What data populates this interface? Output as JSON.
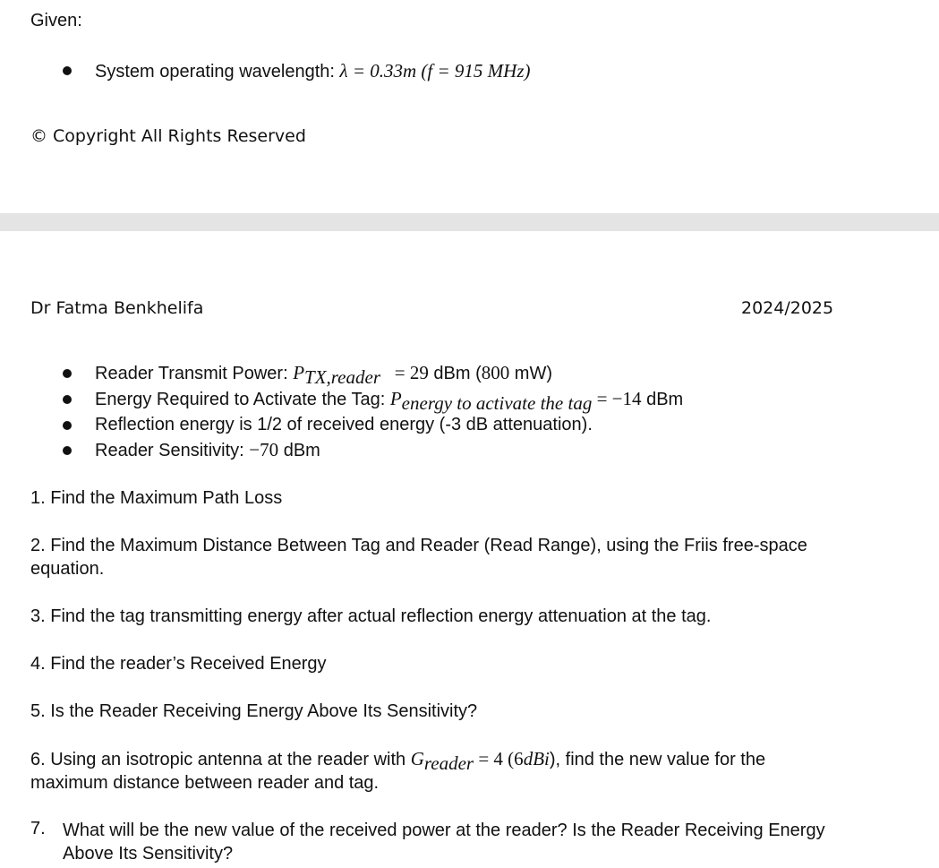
{
  "top": {
    "heading": "Given:",
    "wavelength_label": "System operating wavelength: ",
    "wavelength_math": "λ = 0.33m (f  =  915 MHz)",
    "copyright": "© Copyright All Rights Reserved"
  },
  "header": {
    "author": "Dr Fatma Benkhelifa",
    "year": "2024/2025"
  },
  "given": {
    "tx_label": "Reader Transmit Power: ",
    "tx_sym": "P",
    "tx_sub": "TX,reader",
    "tx_eq": "   = 29",
    "tx_unit": " dBm (",
    "tx_mw": "800",
    "tx_end": " mW)",
    "energy_label": "Energy Required to Activate the Tag: ",
    "energy_sym": "P",
    "energy_sub": "energy to activate the tag",
    "energy_eq": " = −14",
    "energy_unit": " dBm",
    "reflection": "Reflection energy is 1/2 of received energy (-3 dB attenuation).",
    "sens_label": "Reader Sensitivity: ",
    "sens_val": "−70",
    "sens_unit": " dBm"
  },
  "questions": {
    "q1": "1. Find the Maximum Path Loss",
    "q2": "2. Find the Maximum Distance Between Tag and Reader (Read Range), using the Friis free-space equation.",
    "q3": "3. Find the tag transmitting energy after actual reflection energy attenuation at the tag.",
    "q4": "4. Find the reader’s Received Energy",
    "q5": "5. Is the Reader Receiving Energy Above Its Sensitivity?",
    "q6_a": "6. Using an isotropic antenna at the reader with ",
    "q6_sym": "G",
    "q6_sub": "reader",
    "q6_eq": " = 4 (6",
    "q6_dbi": "dBi",
    "q6_b": "), find the new value for the maximum distance between reader and tag.",
    "q7_num": "7.",
    "q7": "What will be the new value of the received power at the reader? Is the Reader Receiving Energy Above Its Sensitivity?"
  }
}
